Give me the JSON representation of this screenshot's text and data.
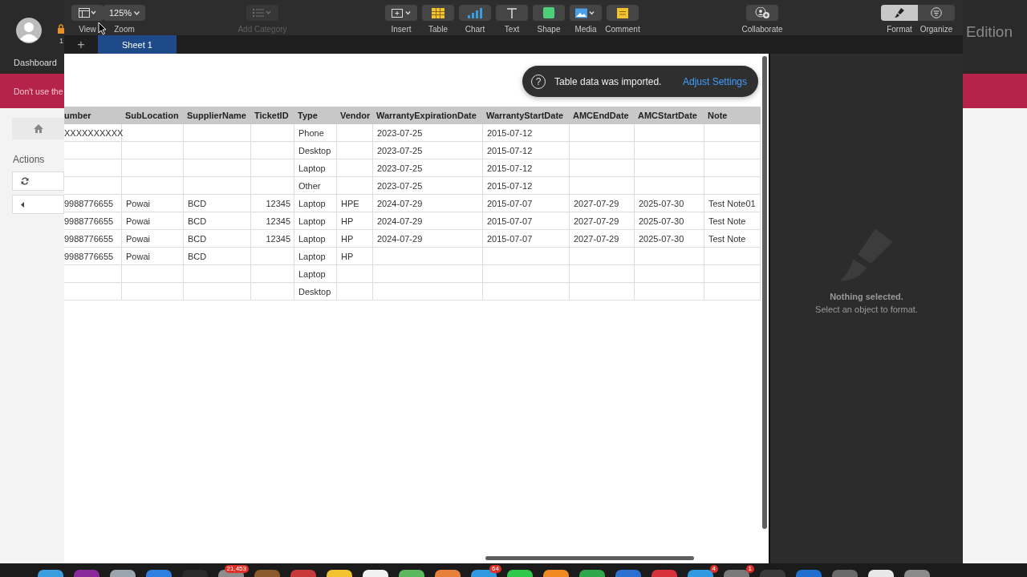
{
  "background_page": {
    "user_link": "Dashboard",
    "lock_badge": "1",
    "edition_text": "Edition",
    "alert": "Don't use the",
    "sidebar": {
      "heading": "Actions"
    }
  },
  "window": {
    "toolbar": {
      "view_controls": [
        {
          "label": "View",
          "kind": "view",
          "disabled": false
        },
        {
          "label": "Zoom",
          "kind": "zoom",
          "value": "125%",
          "disabled": false
        }
      ],
      "category": [
        {
          "label": "Add Category",
          "kind": "category",
          "disabled": true
        }
      ],
      "insert_tools": [
        {
          "label": "Insert",
          "kind": "insert",
          "disabled": false
        },
        {
          "label": "Table",
          "kind": "table",
          "disabled": false
        },
        {
          "label": "Chart",
          "kind": "chart",
          "disabled": false
        },
        {
          "label": "Text",
          "kind": "text",
          "disabled": false
        },
        {
          "label": "Shape",
          "kind": "shape",
          "disabled": false
        },
        {
          "label": "Media",
          "kind": "media",
          "disabled": false
        },
        {
          "label": "Comment",
          "kind": "comment",
          "disabled": false
        }
      ],
      "collaborate": [
        {
          "label": "Collaborate",
          "kind": "collaborate",
          "disabled": false
        }
      ],
      "inspector_tabs": [
        {
          "label": "Format",
          "kind": "format",
          "selected": true
        },
        {
          "label": "Organize",
          "kind": "organize",
          "selected": false
        }
      ]
    },
    "add_sheet": "+",
    "sheet_tabs": [
      {
        "label": "Sheet 1",
        "selected": true
      }
    ],
    "notice": {
      "icon": "?",
      "message": "Table data was imported.",
      "action": "Adjust Settings"
    },
    "table": {
      "columns": [
        "umber",
        "SubLocation",
        "SupplierName",
        "TicketID",
        "Type",
        "Vendor",
        "WarrantyExpirationDate",
        "WarrantyStartDate",
        "AMCEndDate",
        "AMCStartDate",
        "Note"
      ],
      "rows": [
        [
          "XXXXXXXXXX",
          null,
          null,
          null,
          "Phone",
          null,
          "2023-07-25",
          "2015-07-12",
          null,
          null,
          null
        ],
        [
          null,
          null,
          null,
          null,
          "Desktop",
          null,
          "2023-07-25",
          "2015-07-12",
          null,
          null,
          null
        ],
        [
          null,
          null,
          null,
          null,
          "Laptop",
          null,
          "2023-07-25",
          "2015-07-12",
          null,
          null,
          null
        ],
        [
          null,
          null,
          null,
          null,
          "Other",
          null,
          "2023-07-25",
          "2015-07-12",
          null,
          null,
          null
        ],
        [
          "9988776655",
          "Powai",
          "BCD",
          "12345",
          "Laptop",
          "HPE",
          "2024-07-29",
          "2015-07-07",
          "2027-07-29",
          "2025-07-30",
          "Test Note01"
        ],
        [
          "9988776655",
          "Powai",
          "BCD",
          "12345",
          "Laptop",
          "HP",
          "2024-07-29",
          "2015-07-07",
          "2027-07-29",
          "2025-07-30",
          "Test Note"
        ],
        [
          "9988776655",
          "Powai",
          "BCD",
          "12345",
          "Laptop",
          "HP",
          "2024-07-29",
          "2015-07-07",
          "2027-07-29",
          "2025-07-30",
          "Test Note"
        ],
        [
          "9988776655",
          "Powai",
          "BCD",
          null,
          "Laptop",
          "HP",
          null,
          null,
          null,
          null,
          null
        ],
        [
          null,
          null,
          null,
          null,
          "Laptop",
          null,
          null,
          null,
          null,
          null,
          null
        ],
        [
          null,
          null,
          null,
          null,
          "Desktop",
          null,
          null,
          null,
          null,
          null,
          null
        ]
      ]
    },
    "inspector": {
      "title": "Nothing selected.",
      "hint": "Select an object to format."
    }
  },
  "dock": {
    "apps": [
      {
        "color": "#3a9de0"
      },
      {
        "color": "#8a2a9a"
      },
      {
        "color": "#9aa4ad"
      },
      {
        "color": "#2f7fe0"
      },
      {
        "color": "#2a2a2a"
      },
      {
        "color": "#8d8d8d",
        "badge": "21,453"
      },
      {
        "color": "#8a5a2a"
      },
      {
        "color": "#c83a3a"
      },
      {
        "color": "#f2c230"
      },
      {
        "color": "#f0f0f0"
      },
      {
        "color": "#5cb85c"
      },
      {
        "color": "#e8803a"
      },
      {
        "color": "#2f9ae0",
        "badge": "64"
      },
      {
        "color": "#2ec84a"
      },
      {
        "color": "#f08a20"
      },
      {
        "color": "#2ea84a"
      },
      {
        "color": "#2a70d0"
      },
      {
        "color": "#d8303a"
      },
      {
        "color": "#2f9ae0",
        "badge": "4"
      },
      {
        "color": "#7a7a7a",
        "badge": "1"
      },
      {
        "color": "#3a3a3a"
      },
      {
        "color": "#1f6fd0"
      },
      {
        "color": "#6a6a6a"
      },
      {
        "color": "#e8e8e8"
      },
      {
        "color": "#8a8a8a"
      }
    ]
  }
}
